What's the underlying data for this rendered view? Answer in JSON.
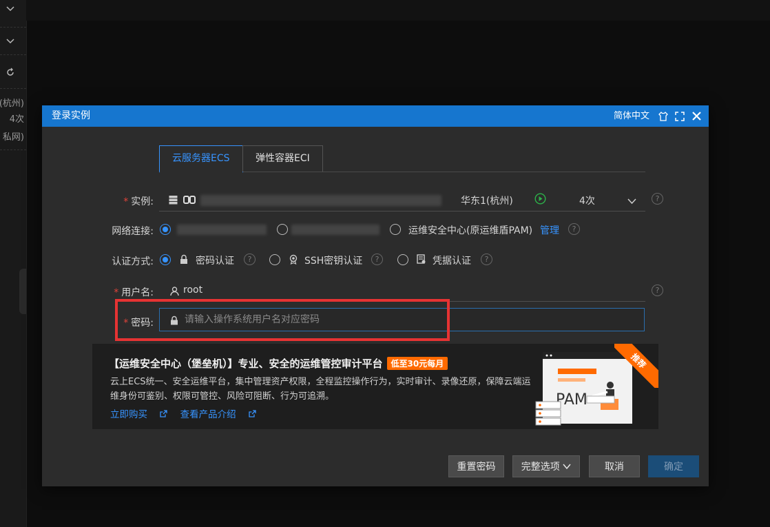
{
  "background": {
    "left_items": [
      "(杭州)",
      "4次",
      "私网)"
    ]
  },
  "dialog": {
    "title": "登录实例",
    "language": "简体中文",
    "tabs": [
      {
        "label": "云服务器ECS",
        "active": true
      },
      {
        "label": "弹性容器ECI",
        "active": false
      }
    ],
    "instance": {
      "label": "实例:",
      "region": "华东1(杭州)",
      "count": "4次"
    },
    "network": {
      "label": "网络连接:",
      "option3": "运维安全中心(原运维盾PAM)",
      "manage_link": "管理"
    },
    "auth": {
      "label": "认证方式:",
      "options": [
        "密码认证",
        "SSH密钥认证",
        "凭据认证"
      ],
      "selected": "密码认证"
    },
    "username": {
      "label": "用户名:",
      "value": "root"
    },
    "password": {
      "label": "密码:",
      "placeholder": "请输入操作系统用户名对应密码"
    },
    "promo": {
      "title": "【运维安全中心（堡垒机）】专业、安全的运维管控审计平台",
      "badge": "低至30元每月",
      "description": "云上ECS统一、安全运维平台，集中管理资产权限，全程监控操作行为，实时审计、录像还原，保障云端运维身份可鉴别、权限可管控、风险可阻断、行为可追溯。",
      "buy_link": "立即购买",
      "intro_link": "查看产品介绍",
      "ribbon": "推荐",
      "illustration_text": "PAM"
    },
    "buttons": {
      "reset_password": "重置密码",
      "full_options": "完整选项",
      "cancel": "取消",
      "confirm": "确定"
    },
    "colors": {
      "header": "#1676cf",
      "accent": "#3794ff",
      "highlight": "#e63333",
      "badge": "#ff6a00"
    }
  }
}
